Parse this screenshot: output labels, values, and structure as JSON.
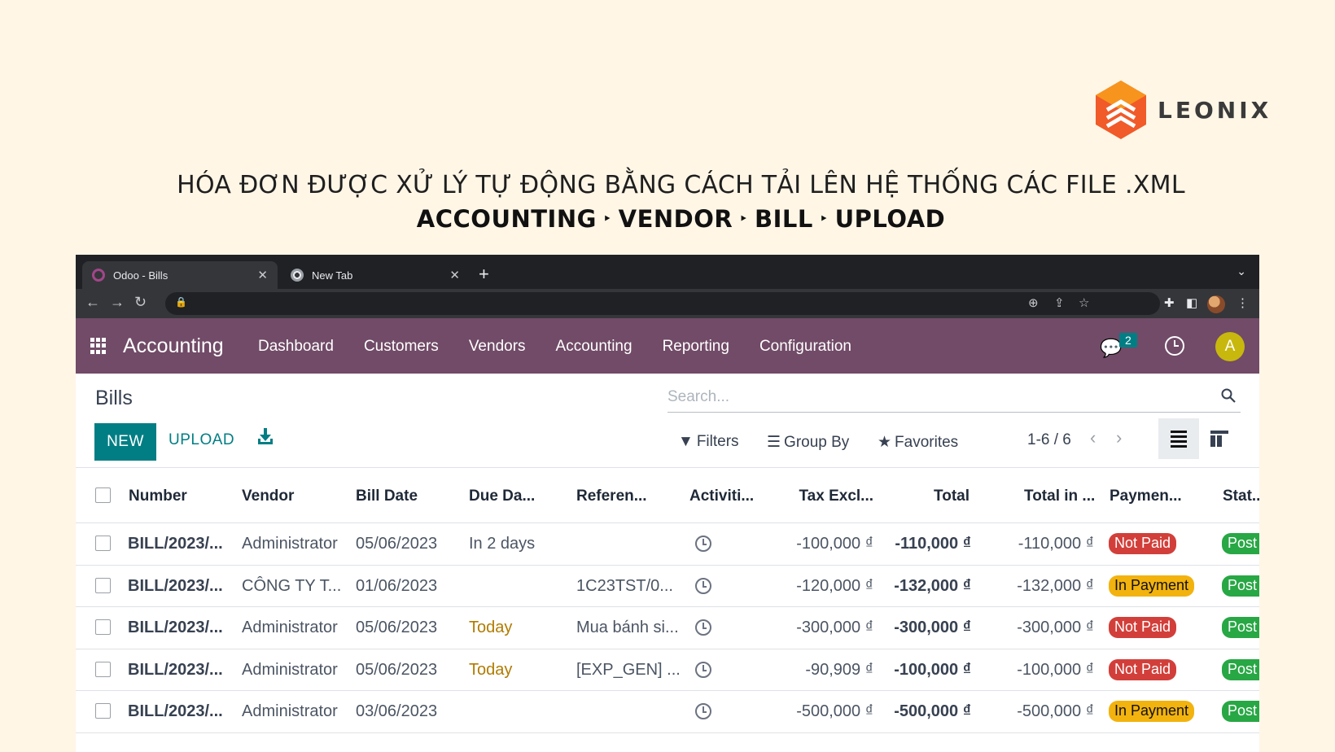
{
  "brand": {
    "name": "LEONIX",
    "colors": {
      "primary": "#f15a29",
      "secondary": "#f7941d"
    }
  },
  "headline": "HÓA ĐƠN ĐƯỢC XỬ LÝ TỰ ĐỘNG BẰNG CÁCH TẢI LÊN HỆ THỐNG CÁC FILE .XML",
  "path": {
    "step1": "ACCOUNTING",
    "step2": "VENDOR",
    "step3": "BILL",
    "step4": "UPLOAD",
    "separator": "‣"
  },
  "browser": {
    "tabs": [
      {
        "title": "Odoo - Bills",
        "icon": "odoo-favicon-icon"
      },
      {
        "title": "New Tab",
        "icon": "chrome-icon"
      }
    ],
    "new_tab": "+",
    "close": "✕"
  },
  "odoo": {
    "app_name": "Accounting",
    "menu": [
      "Dashboard",
      "Customers",
      "Vendors",
      "Accounting",
      "Reporting",
      "Configuration"
    ],
    "chat_count": "2",
    "user_initial": "A",
    "colors": {
      "navbar": "#714b67",
      "primary": "#017e84"
    }
  },
  "control": {
    "title": "Bills",
    "new_label": "NEW",
    "upload_label": "UPLOAD",
    "search_placeholder": "Search...",
    "filters": "Filters",
    "group_by": "Group By",
    "favorites": "Favorites",
    "pager": "1-6 / 6"
  },
  "table": {
    "columns": [
      "Number",
      "Vendor",
      "Bill Date",
      "Due Da...",
      "Referen...",
      "Activiti...",
      "Tax Excl...",
      "Total",
      "Total in ...",
      "Paymen...",
      "Stat..."
    ],
    "rows": [
      {
        "number": "BILL/2023/...",
        "vendor": "Administrator",
        "bill_date": "05/06/2023",
        "due": "In 2 days",
        "due_today": false,
        "ref": "",
        "tax_excl": "-100,000 ₫",
        "total": "-110,000 ₫",
        "total_in": "-110,000 ₫",
        "payment": "Not Paid",
        "payment_color": "red",
        "status": "Post"
      },
      {
        "number": "BILL/2023/...",
        "vendor": "CÔNG TY T...",
        "bill_date": "01/06/2023",
        "due": "",
        "due_today": false,
        "ref": "1C23TST/0...",
        "tax_excl": "-120,000 ₫",
        "total": "-132,000 ₫",
        "total_in": "-132,000 ₫",
        "payment": "In Payment",
        "payment_color": "yellow",
        "status": "Post"
      },
      {
        "number": "BILL/2023/...",
        "vendor": "Administrator",
        "bill_date": "05/06/2023",
        "due": "Today",
        "due_today": true,
        "ref": "Mua bánh si...",
        "tax_excl": "-300,000 ₫",
        "total": "-300,000 ₫",
        "total_in": "-300,000 ₫",
        "payment": "Not Paid",
        "payment_color": "red",
        "status": "Post"
      },
      {
        "number": "BILL/2023/...",
        "vendor": "Administrator",
        "bill_date": "05/06/2023",
        "due": "Today",
        "due_today": true,
        "ref": "[EXP_GEN] ...",
        "tax_excl": "-90,909 ₫",
        "total": "-100,000 ₫",
        "total_in": "-100,000 ₫",
        "payment": "Not Paid",
        "payment_color": "red",
        "status": "Post"
      },
      {
        "number": "BILL/2023/...",
        "vendor": "Administrator",
        "bill_date": "03/06/2023",
        "due": "",
        "due_today": false,
        "ref": "",
        "tax_excl": "-500,000 ₫",
        "total": "-500,000 ₫",
        "total_in": "-500,000 ₫",
        "payment": "In Payment",
        "payment_color": "yellow",
        "status": "Post"
      }
    ]
  }
}
